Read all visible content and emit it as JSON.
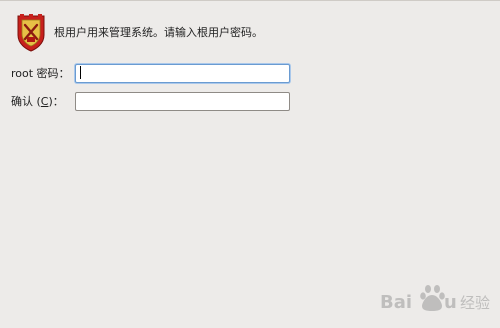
{
  "header": {
    "message": "根用户用来管理系统。请输入根用户密码。",
    "icon": "shield-icon"
  },
  "form": {
    "password": {
      "label_prefix": "root 密码",
      "label_suffix": "：",
      "value": ""
    },
    "confirm": {
      "label_prefix": "确认 (",
      "mnemonic": "C",
      "label_suffix": ")：",
      "value": ""
    }
  },
  "watermark": {
    "text": "Baidu 经验"
  },
  "colors": {
    "background": "#edebe9",
    "shield_red": "#c8201c",
    "shield_gold": "#e0b030",
    "focus_border": "#6a9bd1"
  }
}
